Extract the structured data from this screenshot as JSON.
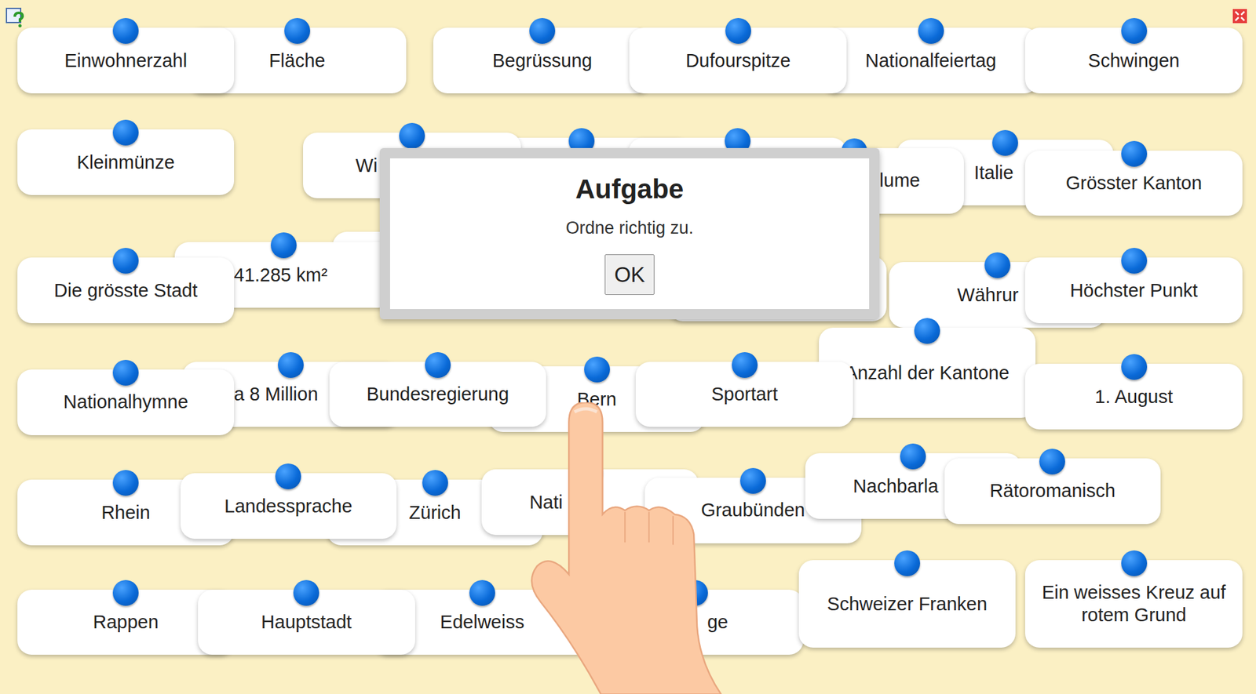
{
  "cards": [
    {
      "text": "Fläche"
    },
    {
      "text": "Einwohnerzahl"
    },
    {
      "text": "Begrüssung"
    },
    {
      "text": "Nationalfeiertag"
    },
    {
      "text": "Dufourspitze"
    },
    {
      "text": "Schwingen"
    },
    {
      "text": "Kleinmünze"
    },
    {
      "text": "Wi"
    },
    {
      "text": "Italie"
    },
    {
      "text": "lume"
    },
    {
      "text": "Grösster Kanton"
    },
    {
      "text": "41.285 km²"
    },
    {
      "text": "Die grösste Stadt"
    },
    {
      "text": "Währur"
    },
    {
      "text": "Höchster Punkt"
    },
    {
      "text": "Anzahl der Kantone"
    },
    {
      "text": "a 8 Million"
    },
    {
      "text": "Nationalhymne"
    },
    {
      "text": "Bern"
    },
    {
      "text": "Bundesregierung"
    },
    {
      "text": "Sportart"
    },
    {
      "text": "1. August"
    },
    {
      "text": "Rhein"
    },
    {
      "text": "Zürich"
    },
    {
      "text": "Landessprache"
    },
    {
      "text": "Nati"
    },
    {
      "text": "Graubünden"
    },
    {
      "text": "Nachbarla"
    },
    {
      "text": "Rätoromanisch"
    },
    {
      "text": "Rappen"
    },
    {
      "text": "Edelweiss"
    },
    {
      "text": "Hauptstadt"
    },
    {
      "text": "ge"
    },
    {
      "text": "Schweizer Franken"
    },
    {
      "text": "Ein weisses Kreuz auf rotem Grund"
    }
  ],
  "dialog": {
    "title": "Aufgabe",
    "message": "Ordne richtig zu.",
    "button": "OK"
  }
}
